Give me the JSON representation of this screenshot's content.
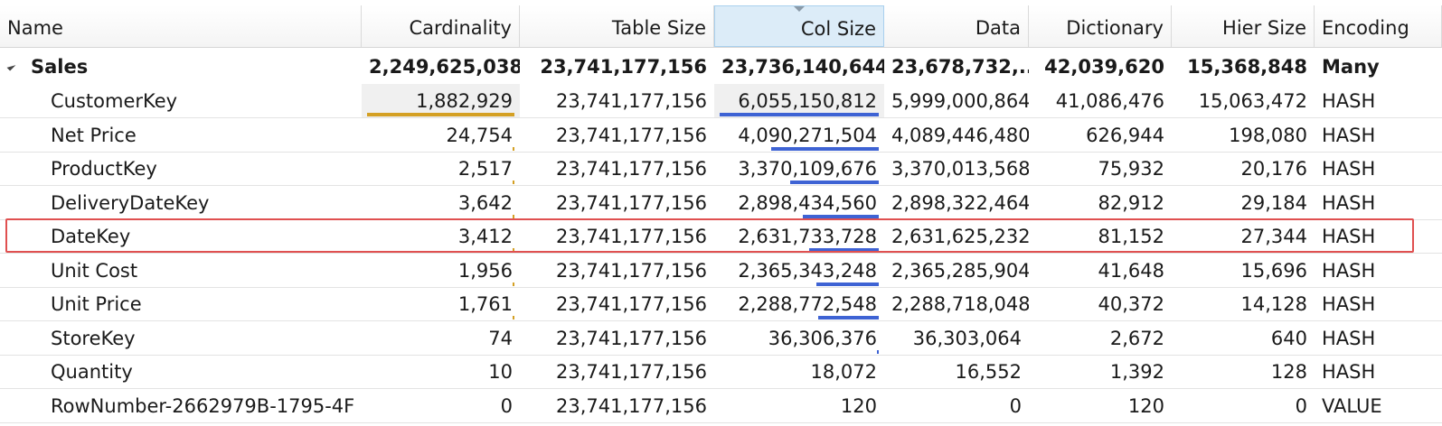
{
  "columns": {
    "name": "Name",
    "cardinality": "Cardinality",
    "table_size": "Table Size",
    "col_size": "Col Size",
    "data": "Data",
    "dictionary": "Dictionary",
    "hier_size": "Hier Size",
    "encoding": "Encoding"
  },
  "sorted_column": "Col Size",
  "table": {
    "name": "Sales",
    "cardinality": "2,249,625,038",
    "table_size": "23,741,177,156",
    "col_size": "23,736,140,644",
    "data": "23,678,732,...",
    "dictionary": "42,039,620",
    "hier_size": "15,368,848",
    "encoding": "Many"
  },
  "rows": [
    {
      "name": "CustomerKey",
      "cardinality": "1,882,929",
      "table_size": "23,741,177,156",
      "col_size": "6,055,150,812",
      "data": "5,999,000,864",
      "dictionary": "41,086,476",
      "hier_size": "15,063,472",
      "encoding": "HASH",
      "card_bar": 1.0,
      "col_bar": 1.0
    },
    {
      "name": "Net Price",
      "cardinality": "24,754",
      "table_size": "23,741,177,156",
      "col_size": "4,090,271,504",
      "data": "4,089,446,480",
      "dictionary": "626,944",
      "hier_size": "198,080",
      "encoding": "HASH",
      "card_bar": 0.013,
      "col_bar": 0.675
    },
    {
      "name": "ProductKey",
      "cardinality": "2,517",
      "table_size": "23,741,177,156",
      "col_size": "3,370,109,676",
      "data": "3,370,013,568",
      "dictionary": "75,932",
      "hier_size": "20,176",
      "encoding": "HASH",
      "card_bar": 0.0013,
      "col_bar": 0.557
    },
    {
      "name": "DeliveryDateKey",
      "cardinality": "3,642",
      "table_size": "23,741,177,156",
      "col_size": "2,898,434,560",
      "data": "2,898,322,464",
      "dictionary": "82,912",
      "hier_size": "29,184",
      "encoding": "HASH",
      "card_bar": 0.0019,
      "col_bar": 0.479
    },
    {
      "name": "DateKey",
      "cardinality": "3,412",
      "table_size": "23,741,177,156",
      "col_size": "2,631,733,728",
      "data": "2,631,625,232",
      "dictionary": "81,152",
      "hier_size": "27,344",
      "encoding": "HASH",
      "card_bar": 0.0018,
      "col_bar": 0.435
    },
    {
      "name": "Unit Cost",
      "cardinality": "1,956",
      "table_size": "23,741,177,156",
      "col_size": "2,365,343,248",
      "data": "2,365,285,904",
      "dictionary": "41,648",
      "hier_size": "15,696",
      "encoding": "HASH",
      "card_bar": 0.001,
      "col_bar": 0.391
    },
    {
      "name": "Unit Price",
      "cardinality": "1,761",
      "table_size": "23,741,177,156",
      "col_size": "2,288,772,548",
      "data": "2,288,718,048",
      "dictionary": "40,372",
      "hier_size": "14,128",
      "encoding": "HASH",
      "card_bar": 0.0009,
      "col_bar": 0.378
    },
    {
      "name": "StoreKey",
      "cardinality": "74",
      "table_size": "23,741,177,156",
      "col_size": "36,306,376",
      "data": "36,303,064",
      "dictionary": "2,672",
      "hier_size": "640",
      "encoding": "HASH",
      "card_bar": 0,
      "col_bar": 0.006
    },
    {
      "name": "Quantity",
      "cardinality": "10",
      "table_size": "23,741,177,156",
      "col_size": "18,072",
      "data": "16,552",
      "dictionary": "1,392",
      "hier_size": "128",
      "encoding": "HASH",
      "card_bar": 0,
      "col_bar": 0
    },
    {
      "name": "RowNumber-2662979B-1795-4F",
      "cardinality": "0",
      "table_size": "23,741,177,156",
      "col_size": "120",
      "data": "0",
      "dictionary": "120",
      "hier_size": "0",
      "encoding": "VALUE",
      "card_bar": 0,
      "col_bar": 0
    }
  ],
  "highlighted_row": "DateKey"
}
